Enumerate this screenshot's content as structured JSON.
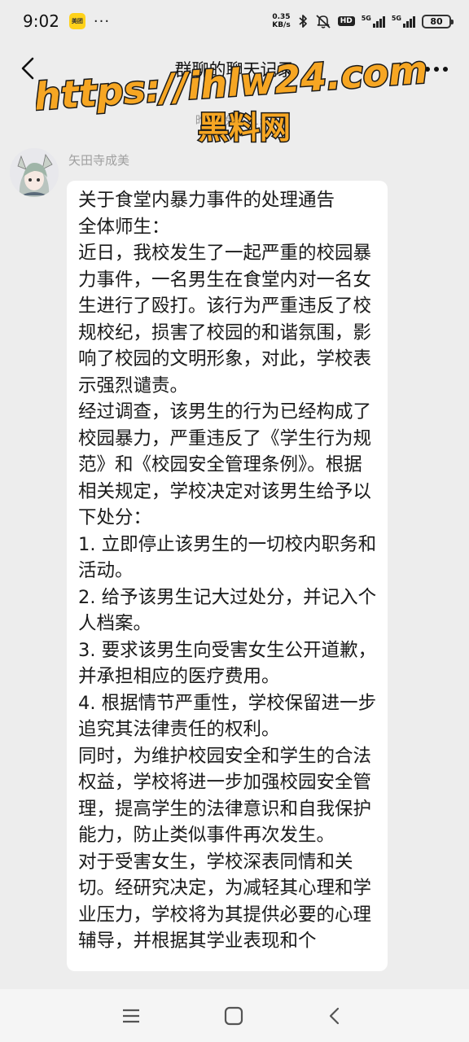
{
  "status_bar": {
    "time": "9:02",
    "app_badge": "美团",
    "more": "···",
    "net_speed_value": "0.35",
    "net_speed_unit": "KB/s",
    "hd": "HD",
    "signal_1": "5G",
    "signal_2": "5G",
    "battery": "80"
  },
  "header": {
    "title": "群聊的聊天记录"
  },
  "chat": {
    "timestamp": "昨天 晚上11:...",
    "sender_name": "矢田寺成美",
    "message_lines": [
      "关于食堂内暴力事件的处理通告",
      "全体师生：",
      "近日，我校发生了一起严重的校园暴力事件，一名男生在食堂内对一名女生进行了殴打。该行为严重违反了校规校纪，损害了校园的和谐氛围，影响了校园的文明形象，对此，学校表示强烈谴责。",
      "经过调查，该男生的行为已经构成了校园暴力，严重违反了《学生行为规范》和《校园安全管理条例》。根据相关规定，学校决定对该男生给予以下处分：",
      "1. 立即停止该男生的一切校内职务和活动。",
      "2. 给予该男生记大过处分，并记入个人档案。",
      "3. 要求该男生向受害女生公开道歉，并承担相应的医疗费用。",
      "4. 根据情节严重性，学校保留进一步追究其法律责任的权利。",
      "同时，为维护校园安全和学生的合法权益，学校将进一步加强校园安全管理，提高学生的法律意识和自我保护能力，防止类似事件再次发生。",
      "对于受害女生，学校深表同情和关切。经研究决定，为减轻其心理和学业压力，学校将为其提供必要的心理辅导，并根据其学业表现和个"
    ]
  },
  "watermark": {
    "url": "https://ihlw24.com",
    "name": "黑料网"
  },
  "colors": {
    "background": "#ededed",
    "bubble": "#ffffff",
    "watermark_fill": "#f6a623",
    "watermark_stroke": "#1a1a1a"
  }
}
